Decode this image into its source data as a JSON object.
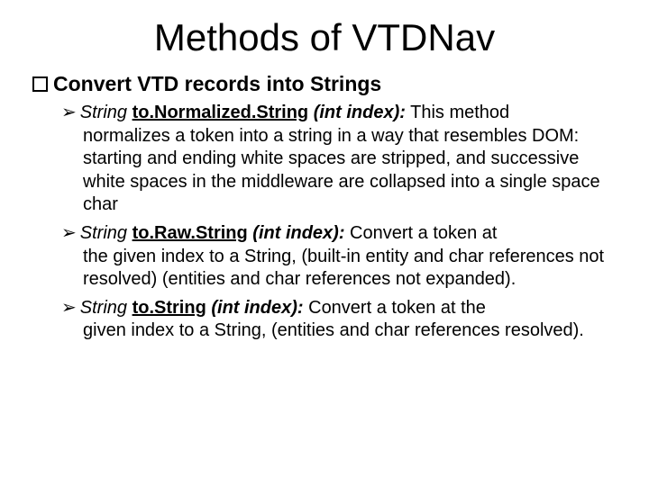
{
  "title": "Methods of VTDNav",
  "section": "Convert VTD records into Strings",
  "items": [
    {
      "ret": "String ",
      "method": "to.Normalized.String",
      "args": " (int index):",
      "lead": " This method",
      "rest": "normalizes a token into a string in a way that resembles DOM: starting and ending white spaces are stripped,  and successive white spaces in the middleware are collapsed into a single space char"
    },
    {
      "ret": "String ",
      "method": "to.Raw.String",
      "args": " (int index):",
      "lead": " Convert a token at",
      "rest": "the given index to a String, (built-in entity and char references not resolved) (entities and char references not expanded)."
    },
    {
      "ret": "String ",
      "method": "to.String",
      "args": " (int index):",
      "lead": " Convert a token at the",
      "rest": "given index to a String, (entities and char references resolved)."
    }
  ]
}
